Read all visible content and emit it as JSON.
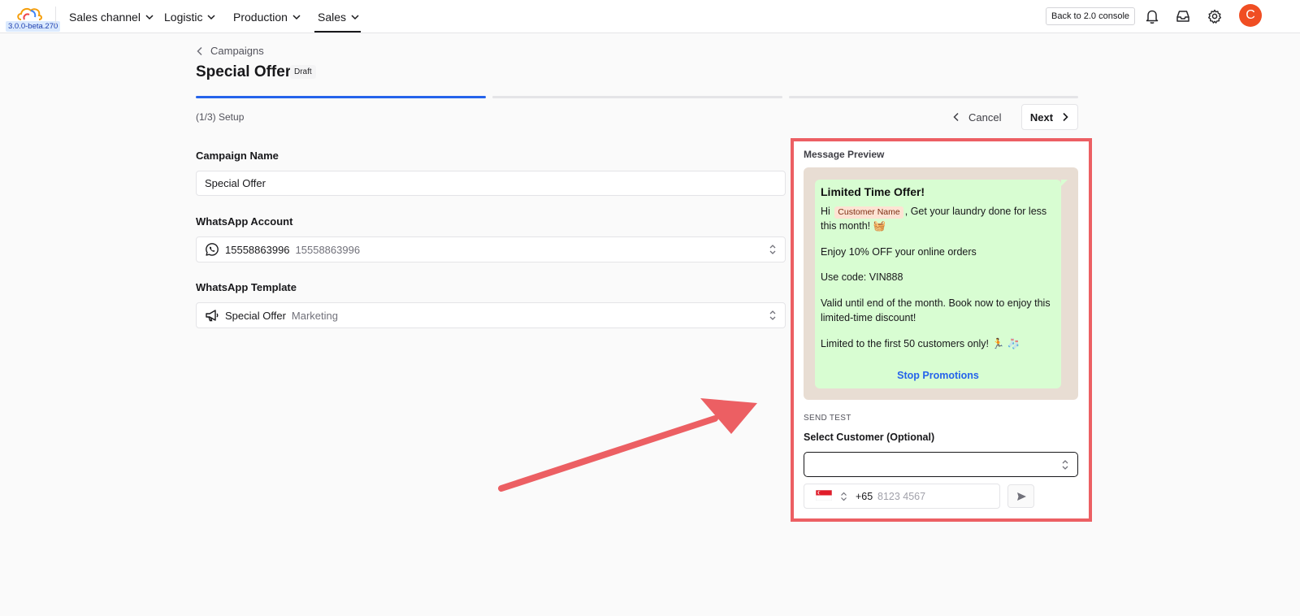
{
  "app": {
    "version": "3.0.0-beta.270",
    "nav": [
      {
        "label": "Sales channel"
      },
      {
        "label": "Logistic"
      },
      {
        "label": "Production"
      },
      {
        "label": "Sales"
      }
    ],
    "console_button": "Back to 2.0 console",
    "avatar_initial": "C"
  },
  "page": {
    "breadcrumb": "Campaigns",
    "title": "Special Offer",
    "status_badge": "Draft",
    "step_label": "(1/3) Setup",
    "cancel_label": "Cancel",
    "next_label": "Next"
  },
  "form": {
    "campaign_name": {
      "label": "Campaign Name",
      "value": "Special Offer"
    },
    "whatsapp_account": {
      "label": "WhatsApp Account",
      "name": "15558863996",
      "number": "15558863996"
    },
    "whatsapp_template": {
      "label": "WhatsApp Template",
      "name": "Special Offer",
      "category": "Marketing"
    }
  },
  "preview": {
    "label": "Message Preview",
    "title": "Limited Time Offer!",
    "greeting_hi": "Hi",
    "customer_chip": "Customer Name",
    "line1_rest": ", Get your laundry done for less",
    "line1b": "this month! 🧺",
    "line2": "Enjoy 10% OFF your online orders",
    "line3": "Use code: VIN888",
    "line4a": "Valid until end of the month. Book now to enjoy this",
    "line4b": "limited-time discount!",
    "line5": "Limited to the first 50 customers only! 🏃 🧦",
    "stop_link": "Stop Promotions"
  },
  "send_test": {
    "section_label": "SEND TEST",
    "select_label": "Select Customer (Optional)",
    "select_value": "",
    "phone_code": "+65",
    "phone_placeholder": "8123 4567"
  },
  "colors": {
    "accent": "#2563eb",
    "highlight": "#ec5f63",
    "bubble": "#d8fdd2",
    "avatar": "#f04e23"
  }
}
